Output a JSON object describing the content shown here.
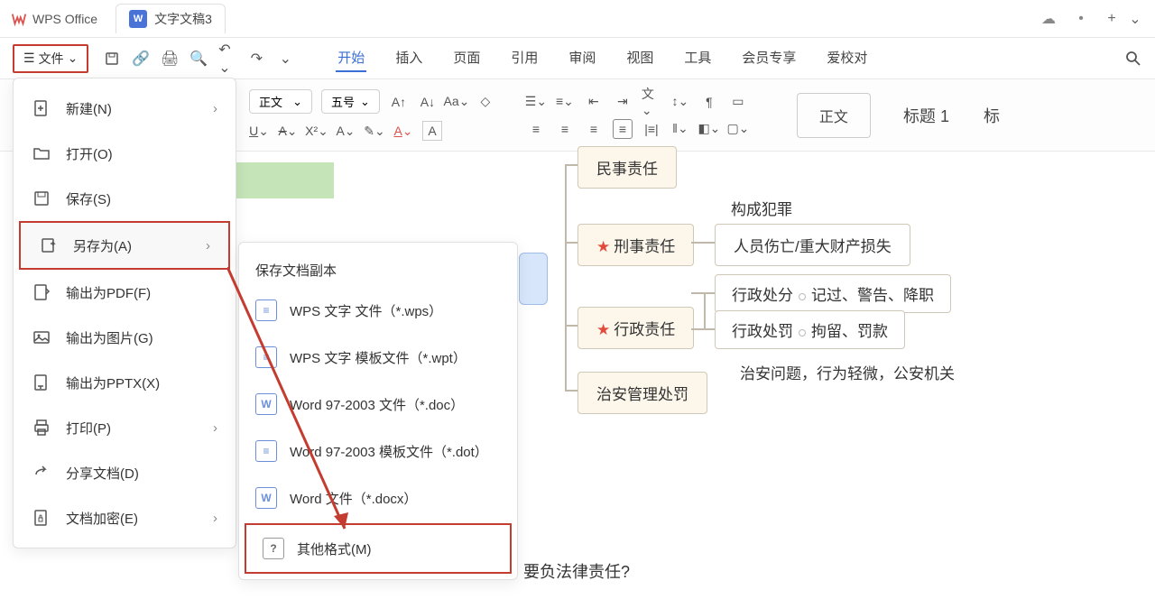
{
  "app": {
    "name": "WPS Office",
    "doc_title": "文字文稿3"
  },
  "menubar": {
    "file_label": "文件",
    "tabs": [
      "开始",
      "插入",
      "页面",
      "引用",
      "审阅",
      "视图",
      "工具",
      "会员专享",
      "爱校对"
    ]
  },
  "toolbar": {
    "font_name": "正文",
    "font_size": "五号",
    "style_body": "正文",
    "style_heading1": "标题 1",
    "style_heading_extra": "标"
  },
  "file_menu": {
    "items": [
      {
        "label": "新建(N)",
        "icon": "plus-doc",
        "chev": true
      },
      {
        "label": "打开(O)",
        "icon": "folder",
        "chev": false
      },
      {
        "label": "保存(S)",
        "icon": "save",
        "chev": false
      },
      {
        "label": "另存为(A)",
        "icon": "saveas",
        "chev": true,
        "hl": true
      },
      {
        "label": "输出为PDF(F)",
        "icon": "pdf",
        "chev": false
      },
      {
        "label": "输出为图片(G)",
        "icon": "image",
        "chev": false
      },
      {
        "label": "输出为PPTX(X)",
        "icon": "pptx",
        "chev": false
      },
      {
        "label": "打印(P)",
        "icon": "print",
        "chev": true
      },
      {
        "label": "分享文档(D)",
        "icon": "share",
        "chev": false
      },
      {
        "label": "文档加密(E)",
        "icon": "lock",
        "chev": true
      }
    ]
  },
  "saveas": {
    "header": "保存文档副本",
    "items": [
      {
        "label": "WPS 文字 文件（*.wps）",
        "ico": "≡"
      },
      {
        "label": "WPS 文字 模板文件（*.wpt）",
        "ico": "≡"
      },
      {
        "label": "Word 97-2003 文件（*.doc）",
        "ico": "W"
      },
      {
        "label": "Word 97-2003 模板文件（*.dot）",
        "ico": "≡"
      },
      {
        "label": "Word 文件（*.docx）",
        "ico": "W"
      },
      {
        "label": "其他格式(M)",
        "ico": "?",
        "boxed": true
      }
    ]
  },
  "diagram": {
    "n0": "民事责任",
    "n1": "刑事责任",
    "n1a": "构成犯罪",
    "n1b": "人员伤亡/重大财产损失",
    "n2": "行政责任",
    "n2a": "行政处分",
    "n2a_r": "记过、警告、降职",
    "n2b": "行政处罚",
    "n2b_r": "拘留、罚款",
    "n3": "治安管理处罚",
    "n3a": "治安问题，行为轻微，公安机关"
  },
  "doc_q": "要负法律责任?"
}
